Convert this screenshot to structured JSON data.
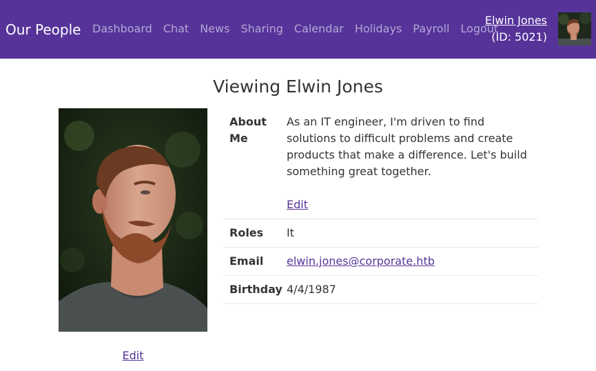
{
  "navbar": {
    "brand": "Our People",
    "links": [
      "Dashboard",
      "Chat",
      "News",
      "Sharing",
      "Calendar",
      "Holidays",
      "Payroll",
      "Logout"
    ],
    "user": {
      "name": "Elwin Jones",
      "id_text": "(ID: 5021)"
    },
    "background_color": "#563399"
  },
  "profile": {
    "title": "Viewing Elwin Jones",
    "photo_edit_label": "Edit",
    "fields": {
      "about_label": "About Me",
      "about_text": "As an IT engineer, I'm driven to find solutions to difficult problems and create products that make a difference. Let's build something great together.",
      "about_edit_label": "Edit",
      "roles_label": "Roles",
      "roles_value": "It",
      "email_label": "Email",
      "email_value": "elwin.jones@corporate.htb",
      "birthday_label": "Birthday",
      "birthday_value": "4/4/1987"
    }
  }
}
